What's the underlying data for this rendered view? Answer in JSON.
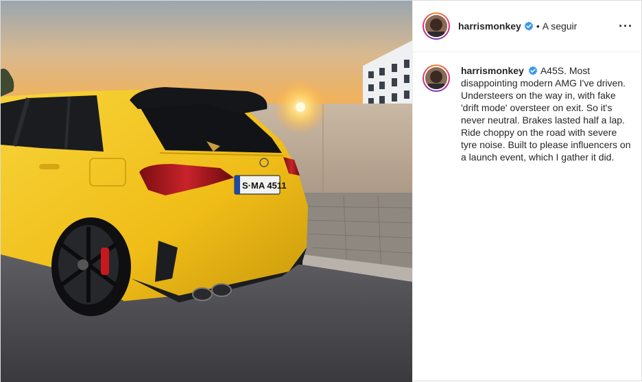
{
  "header": {
    "username": "harrismonkey",
    "separator": "•",
    "follow_label": "A seguir",
    "more_label": "···"
  },
  "caption": {
    "username": "harrismonkey",
    "text": "A45S. Most disappointing modern AMG I've driven. Understeers on the way in, with fake 'drift mode' oversteer on exit. So it's never neutral. Brakes lasted half a lap. Ride choppy on the road with severe tyre noise. Built to please influencers on a launch event, which I gather it did."
  },
  "photo": {
    "license_plate": "S·MA 4511"
  },
  "colors": {
    "verified_blue": "#3897f0",
    "car_yellow": "#f2c21b"
  },
  "icons": [
    "verified-badge-icon",
    "more-options-icon"
  ]
}
